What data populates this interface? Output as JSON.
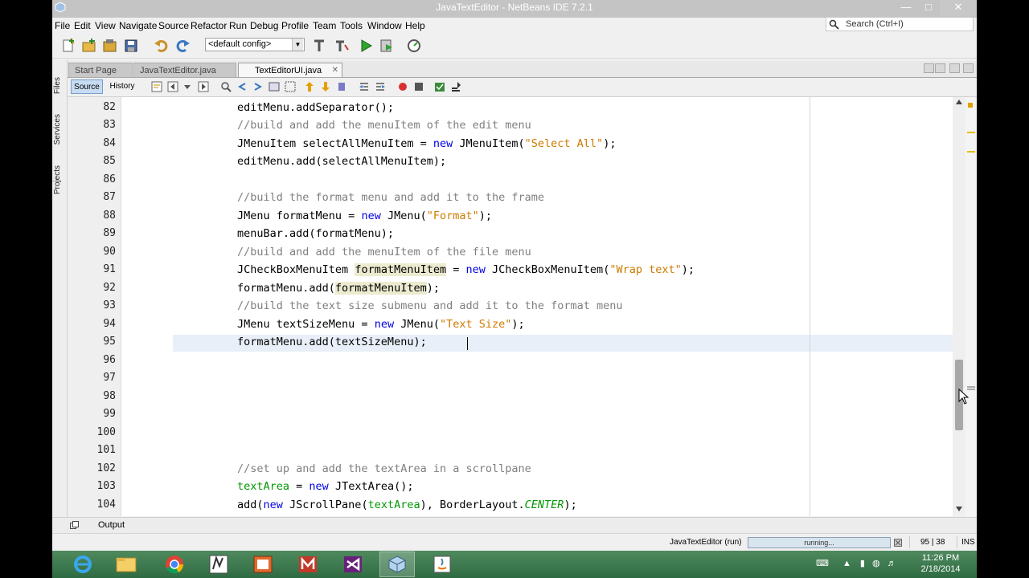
{
  "window": {
    "title": "JavaTextEditor - NetBeans IDE 7.2.1"
  },
  "menu": [
    "File",
    "Edit",
    "View",
    "Navigate",
    "Source",
    "Refactor",
    "Run",
    "Debug",
    "Profile",
    "Team",
    "Tools",
    "Window",
    "Help"
  ],
  "search": {
    "placeholder": "Search (Ctrl+I)"
  },
  "toolbar": {
    "config_value": "<default config>"
  },
  "side_panels": [
    "Files",
    "Services",
    "Projects"
  ],
  "tabs": [
    {
      "label": "Start Page",
      "active": false
    },
    {
      "label": "JavaTextEditor.java",
      "active": false
    },
    {
      "label": "TextEditorUI.java",
      "active": true
    }
  ],
  "editor_toolbar": {
    "source_label": "Source",
    "history_label": "History"
  },
  "editor": {
    "current_line": 95,
    "line_numbers": [
      "82",
      "83",
      "84",
      "85",
      "86",
      "87",
      "88",
      "89",
      "90",
      "91",
      "92",
      "93",
      "94",
      "95",
      "96",
      "97",
      "98",
      "99",
      "100",
      "101",
      "102",
      "103",
      "104"
    ],
    "code_text": {
      "l82": "editMenu.addSeparator();",
      "l83": "//build and add the menuItem of the edit menu",
      "l84a": "JMenuItem selectAllMenuItem = ",
      "l84b": "new",
      "l84c": " JMenuItem(",
      "l84d": "\"Select All\"",
      "l84e": ");",
      "l85": "editMenu.add(selectAllMenuItem);",
      "l87": "//build the format menu and add it to the frame",
      "l88a": "JMenu formatMenu = ",
      "l88b": "new",
      "l88c": " JMenu(",
      "l88d": "\"Format\"",
      "l88e": ");",
      "l89": "menuBar.add(formatMenu);",
      "l90": "//build and add the menuItem of the file menu",
      "l91a": "JCheckBoxMenuItem ",
      "l91b": "formatMenuItem",
      "l91c": " = ",
      "l91d": "new",
      "l91e": " JCheckBoxMenuItem(",
      "l91f": "\"Wrap text\"",
      "l91g": ");",
      "l92a": "formatMenu.add(",
      "l92b": "formatMenuItem",
      "l92c": ");",
      "l93": "//build the text size submenu and add it to the format menu",
      "l94a": "JMenu textSizeMenu = ",
      "l94b": "new",
      "l94c": " JMenu(",
      "l94d": "\"Text Size\"",
      "l94e": ");",
      "l95": "formatMenu.add(textSizeMenu);",
      "l102": "//set up and add the textArea in a scrollpane",
      "l103a": "textArea",
      "l103b": " = ",
      "l103c": "new",
      "l103d": " JTextArea();",
      "l104a": "add(",
      "l104b": "new",
      "l104c": " JScrollPane(",
      "l104d": "textArea",
      "l104e": "), BorderLayout.",
      "l104f": "CENTER",
      "l104g": ");"
    }
  },
  "output": {
    "label": "Output"
  },
  "status": {
    "project": "JavaTextEditor (run)",
    "progress_text": "running...",
    "position": "95 | 38",
    "mode": "INS"
  },
  "taskbar": {
    "time": "11:26 PM",
    "date": "2/18/2014"
  },
  "colors": {
    "keyword": "#0000e6",
    "string": "#ce7b00",
    "comment": "#7f7f7f",
    "field": "#009900",
    "current_line": "#e9eff8",
    "occurrence": "#ecebd0"
  }
}
